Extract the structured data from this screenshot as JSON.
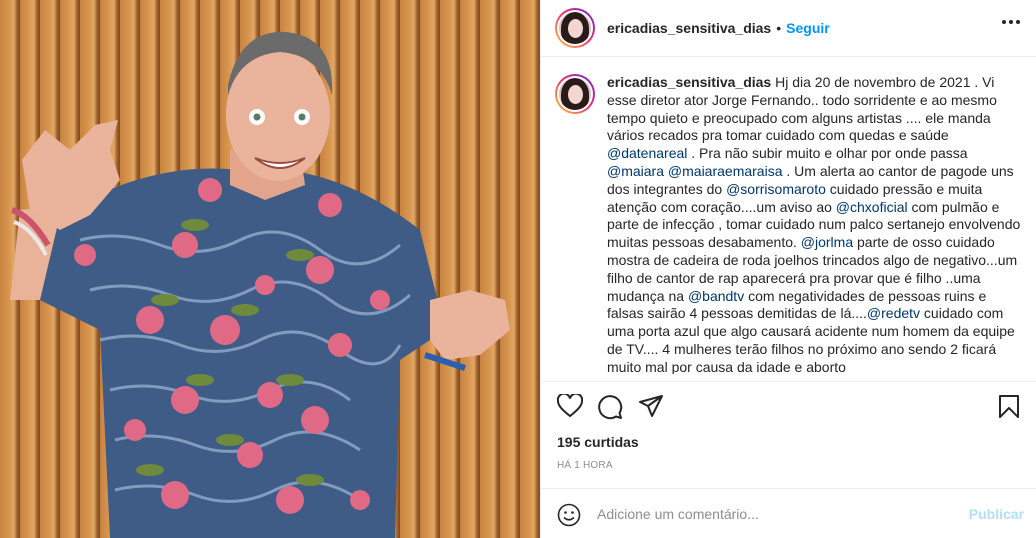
{
  "photo": {
    "alt_subject": ""
  },
  "header": {
    "username": "ericadias_sensitiva_dias",
    "dot": "•",
    "follow_label": "Seguir"
  },
  "caption": {
    "username": "ericadias_sensitiva_dias",
    "segments": [
      {
        "t": " Hj dia 20 de novembro de 2021 . Vi esse diretor ator Jorge Fernando.. todo sorridente e ao mesmo tempo quieto e preocupado com alguns artistas .... ele manda vários recados pra tomar cuidado com quedas e saúde "
      },
      {
        "m": "@datenareal"
      },
      {
        "t": " . Pra não subir muito e olhar por onde passa "
      },
      {
        "m": "@maiara"
      },
      {
        "t": " "
      },
      {
        "m": "@maiaraemaraisa"
      },
      {
        "t": " . Um alerta ao cantor de pagode uns dos integrantes do "
      },
      {
        "m": "@sorrisomaroto"
      },
      {
        "t": " cuidado pressão e muita atenção com coração....um aviso ao "
      },
      {
        "m": "@chxoficial"
      },
      {
        "t": " com pulmão e parte de infecção , tomar cuidado num palco sertanejo envolvendo muitas pessoas desabamento. "
      },
      {
        "m": "@jorlma"
      },
      {
        "t": " parte de osso cuidado mostra de cadeira de roda joelhos trincados algo de negativo...um filho de cantor de rap aparecerá pra provar que é filho ..uma mudança na "
      },
      {
        "m": "@bandtv"
      },
      {
        "t": " com negatividades de pessoas ruins e falsas sairão 4 pessoas demitidas de lá...."
      },
      {
        "m": "@redetv"
      },
      {
        "t": " cuidado com uma porta azul que algo causará acidente num homem da equipe de TV.... 4 mulheres terão filhos no próximo ano sendo 2 ficará muito mal por causa da idade e aborto"
      }
    ]
  },
  "actions": {
    "like_icon": "heart-icon",
    "comment_icon": "comment-icon",
    "share_icon": "share-icon",
    "save_icon": "bookmark-icon"
  },
  "likes": "195 curtidas",
  "timestamp": "HÁ 1 HORA",
  "comment": {
    "placeholder": "Adicione um comentário...",
    "publish_label": "Publicar",
    "emoji_icon": "emoji-icon"
  },
  "colors": {
    "link": "#0095f6",
    "mention": "#00376b",
    "muted": "#8e8e8e",
    "publish_disabled": "#b2dffc"
  }
}
